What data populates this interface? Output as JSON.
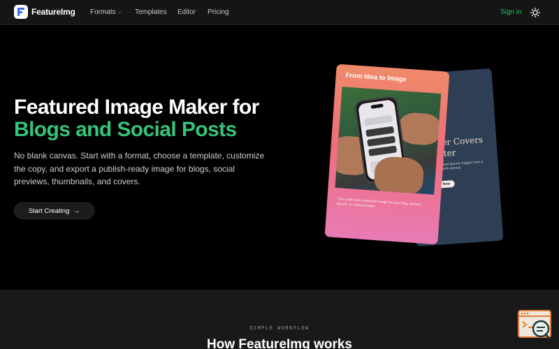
{
  "nav": {
    "brand": "FeatureImg",
    "links": [
      {
        "label": "Formats",
        "has_dropdown": true
      },
      {
        "label": "Templates",
        "has_dropdown": false
      },
      {
        "label": "Editor",
        "has_dropdown": false
      },
      {
        "label": "Pricing",
        "has_dropdown": false
      }
    ],
    "signin": "Sign in",
    "theme_icon": "sun-icon"
  },
  "hero": {
    "title_line1": "Featured Image Maker for",
    "title_line2": "Blogs and Social Posts",
    "description": "No blank canvas. Start with a format, choose a template, customize the copy, and export a publish-ready image for blogs, social previews, thumbnails, and covers.",
    "cta_label": "Start Creating",
    "cta_icon": "arrow-right-icon"
  },
  "illustration": {
    "front_card_title": "From Idea to Image",
    "front_card_caption": "Turn a title into a polished image for your blog, product launch, or social preview.",
    "back_card_line1": "ter Covers",
    "back_card_line2": "ster",
    "back_card_eyebrow": "ng",
    "back_card_small": "d and launch images from a blank canvas.",
    "back_card_button": "ry Now"
  },
  "workflow": {
    "eyebrow": "SIMPLE WORKFLOW",
    "title": "How FeatureImg works"
  },
  "colors": {
    "accent_green": "#34c47a",
    "signin_green": "#22c55e",
    "brand_blue": "#2f6ff2",
    "widget_orange": "#e07b3a"
  }
}
